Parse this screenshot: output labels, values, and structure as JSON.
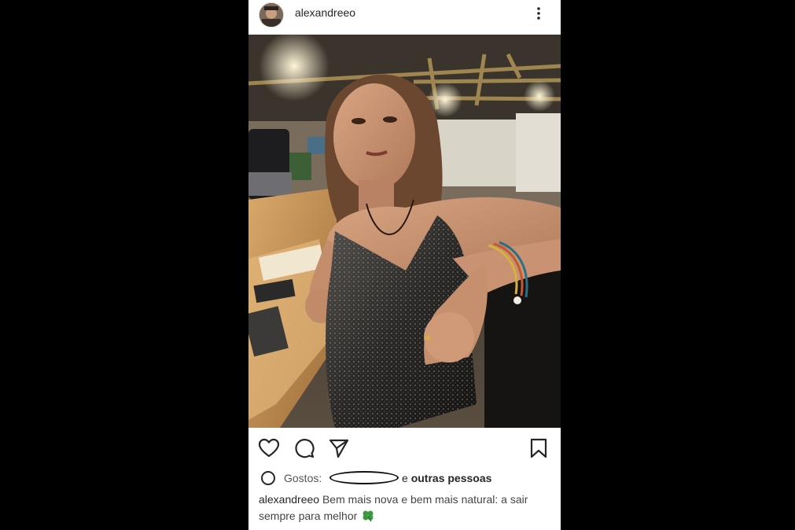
{
  "post": {
    "username": "alexandreeo",
    "more_icon": "more-vertical-icon"
  },
  "photo": {
    "description_icon": "post-photo"
  },
  "actions": {
    "like_icon": "heart-icon",
    "comment_icon": "comment-icon",
    "share_icon": "send-icon",
    "save_icon": "bookmark-icon"
  },
  "likes": {
    "label": "Gostos:",
    "tail_prefix": "e",
    "tail_bold": "outras pessoas"
  },
  "caption": {
    "username": "alexandreeo",
    "text": "Bem mais nova e bem mais natural: a sair sempre para melhor"
  },
  "colors": {
    "background": "#000000",
    "card": "#ffffff",
    "text": "#262626",
    "clover": "#3c9a3c"
  }
}
